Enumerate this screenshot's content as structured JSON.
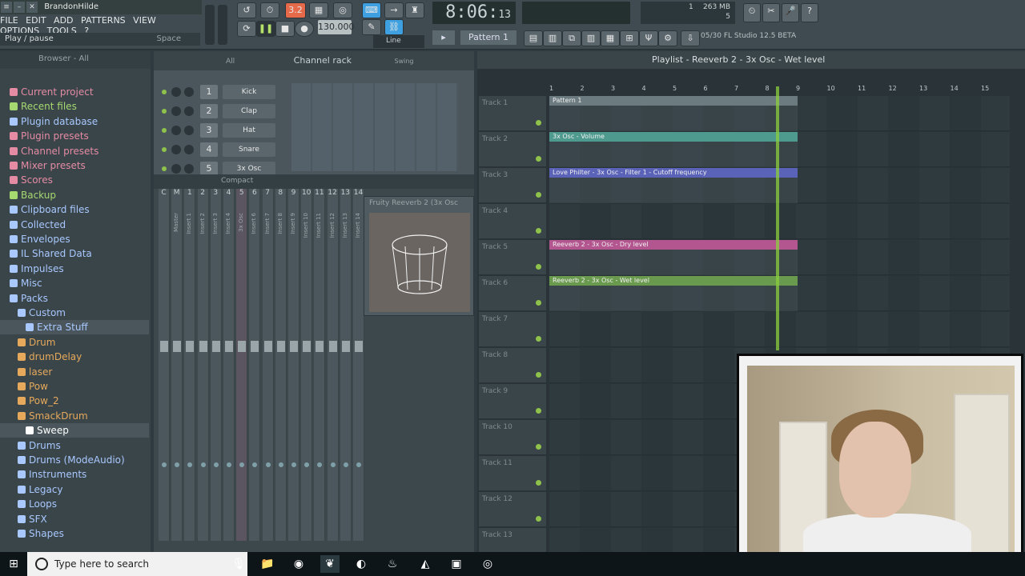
{
  "window": {
    "title": "BrandonHilde"
  },
  "menu": [
    "FILE",
    "EDIT",
    "ADD",
    "PATTERNS",
    "VIEW",
    "OPTIONS",
    "TOOLS",
    "?"
  ],
  "hint": {
    "text": "Play / pause",
    "shortcut": "Space"
  },
  "transport": {
    "time_main": "8:06",
    "time_small": "13",
    "tempo": "130.000",
    "pattern": "Pattern 1",
    "line_mode": "Line",
    "song_mode_badge": "3.2"
  },
  "resources": {
    "memory": "263 MB",
    "cpu_a": "1",
    "cpu_b": "5"
  },
  "news": {
    "counter": "05/30",
    "version": "FL Studio 12.5 BETA"
  },
  "browser": {
    "header": "Browser - All",
    "items": [
      {
        "label": "Current project",
        "color": "#e58ba4"
      },
      {
        "label": "Recent files",
        "color": "#a6d970"
      },
      {
        "label": "Plugin database",
        "color": "#a8c8ff"
      },
      {
        "label": "Plugin presets",
        "color": "#e58ba4"
      },
      {
        "label": "Channel presets",
        "color": "#e58ba4"
      },
      {
        "label": "Mixer presets",
        "color": "#e58ba4"
      },
      {
        "label": "Scores",
        "color": "#e58ba4"
      },
      {
        "label": "Backup",
        "color": "#a6d970"
      },
      {
        "label": "Clipboard files",
        "color": "#a8c8ff"
      },
      {
        "label": "Collected",
        "color": "#a8c8ff"
      },
      {
        "label": "Envelopes",
        "color": "#a8c8ff"
      },
      {
        "label": "IL Shared Data",
        "color": "#a8c8ff"
      },
      {
        "label": "Impulses",
        "color": "#a8c8ff"
      },
      {
        "label": "Misc",
        "color": "#a8c8ff"
      },
      {
        "label": "Packs",
        "color": "#a8c8ff"
      },
      {
        "label": "Custom",
        "color": "#a8c8ff"
      },
      {
        "label": "Extra Stuff",
        "color": "#a8c8ff"
      },
      {
        "label": "Drum",
        "color": "#e6a95c"
      },
      {
        "label": "drumDelay",
        "color": "#e6a95c"
      },
      {
        "label": "laser",
        "color": "#e6a95c"
      },
      {
        "label": "Pow",
        "color": "#e6a95c"
      },
      {
        "label": "Pow_2",
        "color": "#e6a95c"
      },
      {
        "label": "SmackDrum",
        "color": "#e6a95c"
      },
      {
        "label": "Sweep",
        "color": "#ffffff"
      },
      {
        "label": "Drums",
        "color": "#a8c8ff"
      },
      {
        "label": "Drums (ModeAudio)",
        "color": "#a8c8ff"
      },
      {
        "label": "Instruments",
        "color": "#a8c8ff"
      },
      {
        "label": "Legacy",
        "color": "#a8c8ff"
      },
      {
        "label": "Loops",
        "color": "#a8c8ff"
      },
      {
        "label": "SFX",
        "color": "#a8c8ff"
      },
      {
        "label": "Shapes",
        "color": "#a8c8ff"
      }
    ]
  },
  "channel_rack": {
    "title": "Channel rack",
    "filter": "All",
    "swing_label": "Swing",
    "channels": [
      {
        "num": "1",
        "name": "Kick"
      },
      {
        "num": "2",
        "name": "Clap"
      },
      {
        "num": "3",
        "name": "Hat"
      },
      {
        "num": "4",
        "name": "Snare"
      },
      {
        "num": "5",
        "name": "3x Osc"
      }
    ]
  },
  "mixer": {
    "mode": "Compact",
    "strips": [
      "C",
      "M",
      "1",
      "2",
      "3",
      "4",
      "5",
      "6",
      "7",
      "8",
      "9",
      "10",
      "11",
      "12",
      "13",
      "14"
    ],
    "labels": [
      "Master",
      "Insert 1",
      "Insert 2",
      "Insert 3",
      "Insert 4",
      "3x Osc",
      "Insert 6",
      "Insert 7",
      "Insert 8",
      "Insert 9",
      "Insert 10",
      "Insert 11",
      "Insert 12",
      "Insert 13",
      "Insert 14"
    ]
  },
  "plugin": {
    "title": "Fruity Reeverb 2 (3x Osc"
  },
  "playlist": {
    "title": "Playlist - Reeverb 2 - 3x Osc - Wet level",
    "ruler": [
      "1",
      "2",
      "3",
      "4",
      "5",
      "6",
      "7",
      "8",
      "9",
      "10",
      "11",
      "12",
      "13",
      "14",
      "15"
    ],
    "tracks": [
      {
        "label": "Track 1",
        "clip": "Pattern 1",
        "clip_color": "#6b7b80"
      },
      {
        "label": "Track 2",
        "clip": "3x Osc - Volume",
        "clip_color": "#4e9a8e"
      },
      {
        "label": "Track 3",
        "clip": "Love Philter - 3x Osc - Filter 1 - Cutoff frequency",
        "clip_color": "#5a63b8"
      },
      {
        "label": "Track 4",
        "clip": "",
        "clip_color": ""
      },
      {
        "label": "Track 5",
        "clip": "Reeverb 2 - 3x Osc - Dry level",
        "clip_color": "#b3558f"
      },
      {
        "label": "Track 6",
        "clip": "Reeverb 2 - 3x Osc - Wet level",
        "clip_color": "#6a9a4e"
      },
      {
        "label": "Track 7",
        "clip": "",
        "clip_color": ""
      },
      {
        "label": "Track 8",
        "clip": "",
        "clip_color": ""
      },
      {
        "label": "Track 9",
        "clip": "",
        "clip_color": ""
      },
      {
        "label": "Track 10",
        "clip": "",
        "clip_color": ""
      },
      {
        "label": "Track 11",
        "clip": "",
        "clip_color": ""
      },
      {
        "label": "Track 12",
        "clip": "",
        "clip_color": ""
      },
      {
        "label": "Track 13",
        "clip": "",
        "clip_color": ""
      }
    ]
  },
  "taskbar": {
    "search_placeholder": "Type here to search"
  }
}
